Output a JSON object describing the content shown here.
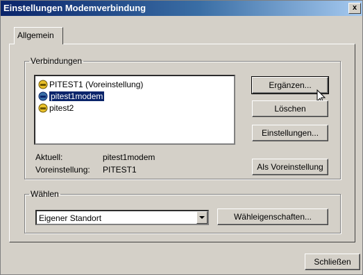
{
  "window": {
    "title": "Einstellungen Modemverbindung",
    "close_label": "x"
  },
  "tabs": [
    {
      "label": "Allgemein"
    }
  ],
  "connections": {
    "group_label": "Verbindungen",
    "items": [
      {
        "label": "PITEST1 (Voreinstellung)",
        "selected": false
      },
      {
        "label": "pitest1modem",
        "selected": true
      },
      {
        "label": "pitest2",
        "selected": false
      }
    ],
    "current_label": "Aktuell:",
    "current_value": "pitest1modem",
    "default_label": "Voreinstellung:",
    "default_value": "PITEST1",
    "buttons": {
      "add": "Ergänzen...",
      "delete": "Löschen",
      "settings": "Einstellungen...",
      "set_default": "Als Voreinstellung"
    }
  },
  "dialing": {
    "group_label": "Wählen",
    "location_value": "Eigener Standort",
    "properties_button": "Wähleigenschaften..."
  },
  "footer": {
    "close_button": "Schließen"
  }
}
